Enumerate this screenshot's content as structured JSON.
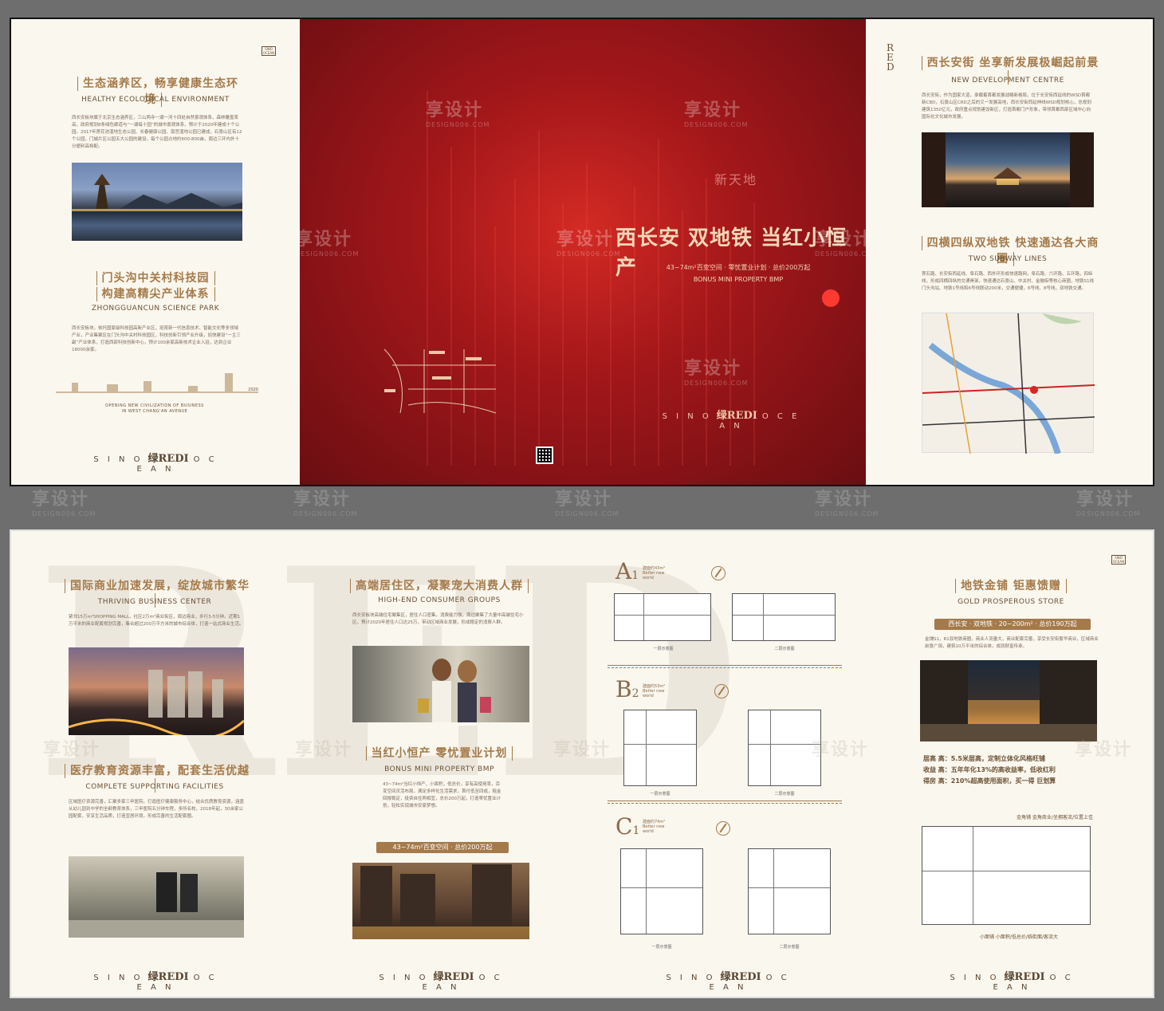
{
  "watermark": {
    "cn": "享设计",
    "en": "DESIGN006.COM"
  },
  "brand": {
    "left": "S I N O",
    "mark": "绿REDI",
    "right": "O C E A N",
    "logo": "SINO OCEAN"
  },
  "top": {
    "left_panel": {
      "sec1_title": "生态涵养区，畅享健康生态环境",
      "sec1_sub": "HEALTHY ECOLOGICAL ENVIRONMENT",
      "sec1_body": "西长安板块属于北京生态涵养区，三山两寺一湖一河十四处自然景观体系，森林覆盖率高，政府规划8条绿色廊道与“一湖每十园”的城市景观体系，预计于2020年建成十个公园。2017年莲花池湿地生态公园、长春健康公园、南宫湿地公园已建成，石景山区有12个公园，门城片区公园五大公园的建设，每个公园占地约600-800亩，周边三环内外十分便利高档配。",
      "sec2_title_l1": "门头沟中关村科技园",
      "sec2_title_l2": "构建高精尖产业体系",
      "sec2_sub": "ZHONGGUANCUN SCIENCE PARK",
      "sec2_body": "西长安板块，依托国家级科技园高新产业区，培育新一代信息技术、智能文化等多领域产业，产业集聚区在门头沟中关村科技园区，科技创新引领产业升级，加快建设“一主三副”产业体系，打造西部科技创新中心，预计100余家高新技术企业入驻，达到企业18000余家。",
      "timeline_caption_l1": "OPENING NEW CIVILIZATION OF BUSINESS",
      "timeline_caption_l2": "IN WEST CHANG'AN AVENUE",
      "timeline_end": "2020"
    },
    "cover": {
      "xintiandi": "新天地",
      "headline": "西长安 双地铁 当红小恒产",
      "sub_l1": "43~74m²百变空间 · 零忧置业计划 · 总价200万起",
      "sub_l2": "BONUS MINI PROPERTY BMP"
    },
    "right_panel": {
      "side_letters": "RED",
      "sec1_title": "西长安街 坐享新发展极崛起前景",
      "sec1_sub": "NEW DEVELOPMENT CENTRE",
      "sec1_body": "西长安街，作为国家大道，承载着首都发展战略新格局，位于长安街西延线的WSD首都新CBD，石景山区CRD之后的又一发展高地，西长安街西延伸线WSD规划核心，总规划建筑1350亿元，政府重点规划建设新区，打造首都门户形象，带领首都西部区域中心向国际化文化城市发展。",
      "sec2_title": "四横四纵双地铁 快速通达各大商圈",
      "sec2_sub": "TWO SUBWAY LINES",
      "sec2_body": "莲石路、长安街西延线、阜石路、西外环形成快速路网，阜石路、六环路、五环路，四纵线，形成四横四纵的交通骨架，快速通达石景山、中关村、金融街等核心商圈，地铁S1线门头沟站、地铁1号线和6号线联动200米，交通便捷，6号线、8号线，双地铁交通。"
    }
  },
  "bottom": {
    "p1": {
      "sec1_title": "国际商业加速发展，绽放城市繁华",
      "sec1_sub": "THRIVING BUSINESS CENTER",
      "sec1_body": "紧邻15万m²SHOPPING MALL，社区2万m²商业街区，周边商业，步行3-5分钟。近期1万平米的商业配套规划完善，集合超过200万平方米的城市综合体，打造一站式商业生活。",
      "sec2_title": "医疗教育资源丰富，配套生活优越",
      "sec2_sub": "COMPLETE SUPPORTING FACILITIES",
      "sec2_body": "区域医疗资源完善，汇聚多家三甲医院，打造医疗健康服务中心，结合优质教育资源，涵盖从幼儿园到中学的全龄教育体系，三甲医院五分钟车程，多所名校，2018年起，30余家公园配套，安享生活品质，打造宜居环境，形成完善的生活配套圈。"
    },
    "p2": {
      "sec1_title": "高端居住区，凝聚宠大消费人群",
      "sec1_sub": "HIGH-END CONSUMER GROUPS",
      "sec1_body": "西长安板块高端住宅聚集区，居住人口密集，消费能力强，周边聚集了大量中高端住宅小区，预计2020年居住人口达25万，带动区域商业发展，形成稳定的消费人群。",
      "sec2_title": "当红小恒产 零忧置业计划",
      "sec2_sub": "BONUS MINI PROPERTY BMP",
      "sec2_body": "43~74m²当红小恒产，小面积，低总价，享有高使用率，百变空间灵活布局，满足多样化生活需求，首付低至四成，租金回报稳定，投资自住两相宜，总价200万起，打造零忧置业计划，轻松实现城市安家梦想。",
      "pill": "43~74m²百变空间 · 总价200万起"
    },
    "p3": {
      "unitA_letter": "A",
      "unitA_sub": "1",
      "unitA_meta": "建面约43m² Better new world",
      "unitB_letter": "B",
      "unitB_sub": "2",
      "unitB_meta": "建面约53m² Better new world",
      "unitC_letter": "C",
      "unitC_sub": "1",
      "unitC_meta": "建面约74m² Better new world",
      "plan_cap_1": "一层示意图",
      "plan_cap_2": "二层示意图"
    },
    "p4": {
      "sec1_title": "地铁金铺 钜惠馈赠",
      "sec1_sub": "GOLD PROSPEROUS STORE",
      "pill": "西长安 · 双地铁 · 20~200m² · 总价190万起",
      "sec1_body": "金铺S1，R1双地铁商圈，商业人流量大，商业配套完善，享受长安街繁华商业，区域商业前景广阔，建筑10万平米的综合体，成就财富传承。",
      "stat1": "层高 高：5.5米层高，定制立体化风格旺铺",
      "stat2": "收益 高：五年年化13%的高收益率，低收红利",
      "stat3": "得房 高：210%超高使用面积，买一得 巨划算",
      "plan_caption": "金角铺 金角商业/坐拥客流/位置上佳",
      "plan_footer": "小面铺 小面积/低总价/临街面/客流大"
    }
  }
}
